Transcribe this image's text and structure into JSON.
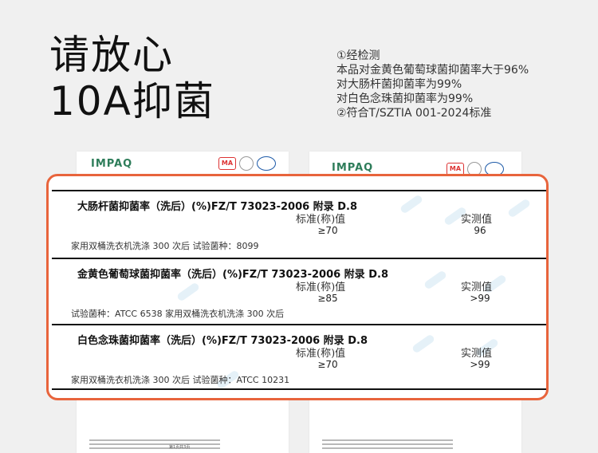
{
  "headline": {
    "line1": "请放心",
    "line2": "10A抑菌"
  },
  "notes": [
    "①经检测",
    "本品对金黄色葡萄球菌抑菌率大于96%",
    "对大肠杆菌抑菌率为99%",
    "对白色念珠菌抑菌率为99%",
    "②符合T/SZTIA 001-2024标准"
  ],
  "report_logo": "IMPAQ",
  "ma_mark": "MA",
  "page_label": "第1页共3页",
  "tests": [
    {
      "title": "大肠杆菌抑菌率（洗后）(%)FZ/T 73023-2006  附录 D.8",
      "std_header": "标准(称)值",
      "meas_header": "实测值",
      "std_value": "≥70",
      "meas_value": "96",
      "note": "家用双桶洗衣机洗涤 300 次后  试验菌种：8099"
    },
    {
      "title": "金黄色葡萄球菌抑菌率（洗后）(%)FZ/T 73023-2006  附录 D.8",
      "std_header": "标准(称)值",
      "meas_header": "实测值",
      "std_value": "≥85",
      "meas_value": ">99",
      "note": "试验菌种：ATCC 6538  家用双桶洗衣机洗涤 300 次后"
    },
    {
      "title": "白色念珠菌抑菌率（洗后）(%)FZ/T 73023-2006  附录 D.8",
      "std_header": "标准(称)值",
      "meas_header": "实测值",
      "std_value": "≥70",
      "meas_value": ">99",
      "note": "家用双桶洗衣机洗涤 300 次后  试验菌种：ATCC 10231"
    }
  ]
}
